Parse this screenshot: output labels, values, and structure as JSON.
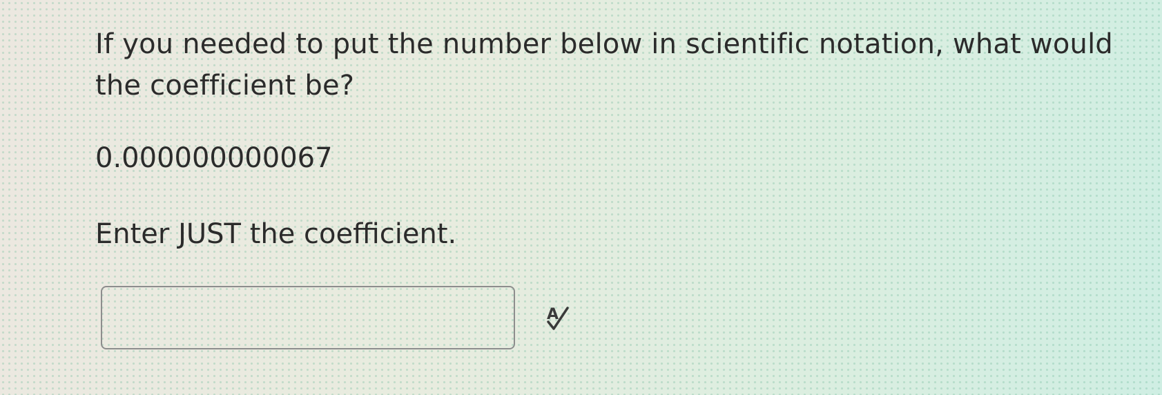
{
  "question": {
    "text": "If you needed to put the number below in scientific notation, what would the coefficient be?"
  },
  "number": "0.000000000067",
  "instruction": "Enter JUST the coefficient.",
  "answer": {
    "value": "",
    "placeholder": ""
  },
  "icons": {
    "spellcheck": "spellcheck-icon"
  },
  "colors": {
    "text": "#2b2b2b",
    "input_border": "#8d8d8d"
  }
}
